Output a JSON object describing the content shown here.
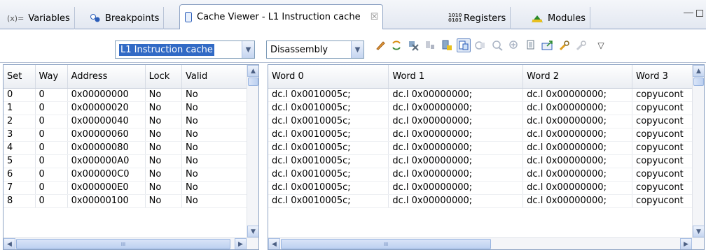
{
  "tabs": [
    {
      "icon": "(x)=",
      "label": "Variables",
      "active": false
    },
    {
      "icon": "breakpoint-icon",
      "label": "Breakpoints",
      "active": false
    },
    {
      "icon": "cache-icon",
      "label": "Cache Viewer - L1 Instruction cache",
      "active": true,
      "close": "☒"
    },
    {
      "icon": "1010 0101",
      "label": "Registers",
      "active": false
    },
    {
      "icon": "modules-icon",
      "label": "Modules",
      "active": false
    }
  ],
  "toolbar": {
    "cache_select": "L1 Instruction cache",
    "view_select": "Disassembly",
    "dropdown_arrow": "▽"
  },
  "left_table": {
    "columns": [
      "Set",
      "Way",
      "Address",
      "Lock",
      "Valid"
    ],
    "rows": [
      [
        "0",
        "0",
        "0x00000000",
        "No",
        "No"
      ],
      [
        "1",
        "0",
        "0x00000020",
        "No",
        "No"
      ],
      [
        "2",
        "0",
        "0x00000040",
        "No",
        "No"
      ],
      [
        "3",
        "0",
        "0x00000060",
        "No",
        "No"
      ],
      [
        "4",
        "0",
        "0x00000080",
        "No",
        "No"
      ],
      [
        "5",
        "0",
        "0x000000A0",
        "No",
        "No"
      ],
      [
        "6",
        "0",
        "0x000000C0",
        "No",
        "No"
      ],
      [
        "7",
        "0",
        "0x000000E0",
        "No",
        "No"
      ],
      [
        "8",
        "0",
        "0x00000100",
        "No",
        "No"
      ]
    ],
    "hscroll_grip": "III"
  },
  "right_table": {
    "columns": [
      "Word 0",
      "Word 1",
      "Word 2",
      "Word 3"
    ],
    "rows": [
      [
        "dc.l 0x0010005c;",
        "dc.l 0x00000000;",
        "dc.l 0x00000000;",
        "copyucont"
      ],
      [
        "dc.l 0x0010005c;",
        "dc.l 0x00000000;",
        "dc.l 0x00000000;",
        "copyucont"
      ],
      [
        "dc.l 0x0010005c;",
        "dc.l 0x00000000;",
        "dc.l 0x00000000;",
        "copyucont"
      ],
      [
        "dc.l 0x0010005c;",
        "dc.l 0x00000000;",
        "dc.l 0x00000000;",
        "copyucont"
      ],
      [
        "dc.l 0x0010005c;",
        "dc.l 0x00000000;",
        "dc.l 0x00000000;",
        "copyucont"
      ],
      [
        "dc.l 0x0010005c;",
        "dc.l 0x00000000;",
        "dc.l 0x00000000;",
        "copyucont"
      ],
      [
        "dc.l 0x0010005c;",
        "dc.l 0x00000000;",
        "dc.l 0x00000000;",
        "copyucont"
      ],
      [
        "dc.l 0x0010005c;",
        "dc.l 0x00000000;",
        "dc.l 0x00000000;",
        "copyucont"
      ],
      [
        "dc.l 0x0010005c;",
        "dc.l 0x00000000;",
        "dc.l 0x00000000;",
        "copyucont"
      ]
    ],
    "hscroll_grip": "III"
  },
  "colors": {
    "accent": "#316ac5",
    "border": "#8ea3c4"
  }
}
